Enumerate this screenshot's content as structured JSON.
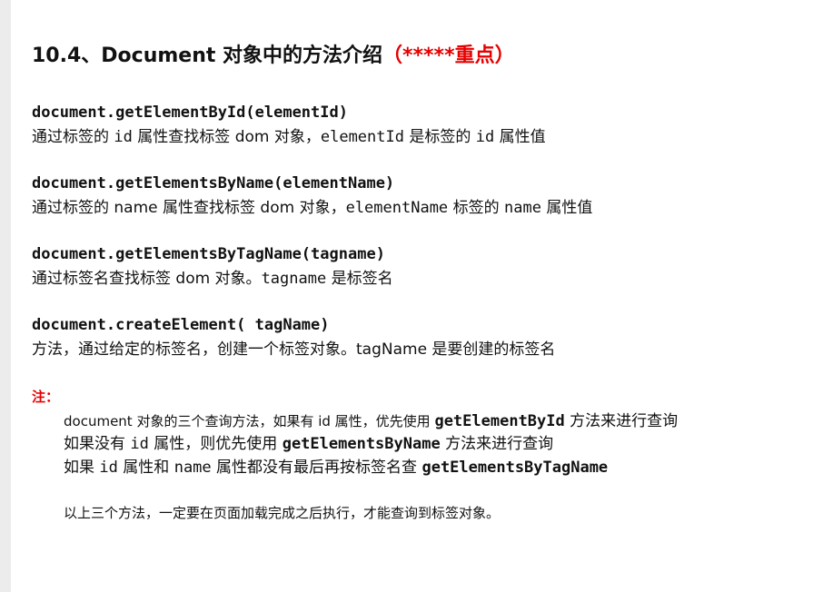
{
  "heading": {
    "text": "10.4、Document 对象中的方法介绍",
    "emphasis": "（*****重点）",
    "emphasis_color": "#e60000"
  },
  "methods": [
    {
      "signature": "document.getElementById(elementId)",
      "desc_parts": [
        "通过标签的 ",
        "id",
        " 属性查找标签 dom 对象，",
        "elementId",
        " 是标签的 ",
        "id",
        " 属性值"
      ]
    },
    {
      "signature": "document.getElementsByName(elementName)",
      "desc_parts": [
        "通过标签的 name 属性查找标签 dom 对象，",
        "elementName",
        " 标签的 ",
        "name",
        " 属性值"
      ]
    },
    {
      "signature": "document.getElementsByTagName(tagname)",
      "desc_parts": [
        "通过标签名查找标签 dom 对象。",
        "tagname",
        " 是标签名"
      ]
    },
    {
      "signature": "document.createElement( tagName)",
      "desc_parts": [
        "方法，通过给定的标签名，创建一个标签对象。tagName 是要创建的标签名"
      ]
    }
  ],
  "note": {
    "label": "注：",
    "line1": [
      "document 对象的三个查询方法，如果有 id 属性，优先使用 ",
      "getElementById",
      " 方法来进行查询"
    ],
    "line2": [
      "如果没有 ",
      "id",
      " 属性，则优先使用 ",
      "getElementsByName",
      " 方法来进行查询"
    ],
    "line3": [
      "如果 ",
      "id",
      " 属性和 ",
      "name",
      " 属性都没有最后再按标签名查 ",
      "getElementsByTagName"
    ],
    "line4": "以上三个方法，一定要在页面加载完成之后执行，才能查询到标签对象。"
  }
}
